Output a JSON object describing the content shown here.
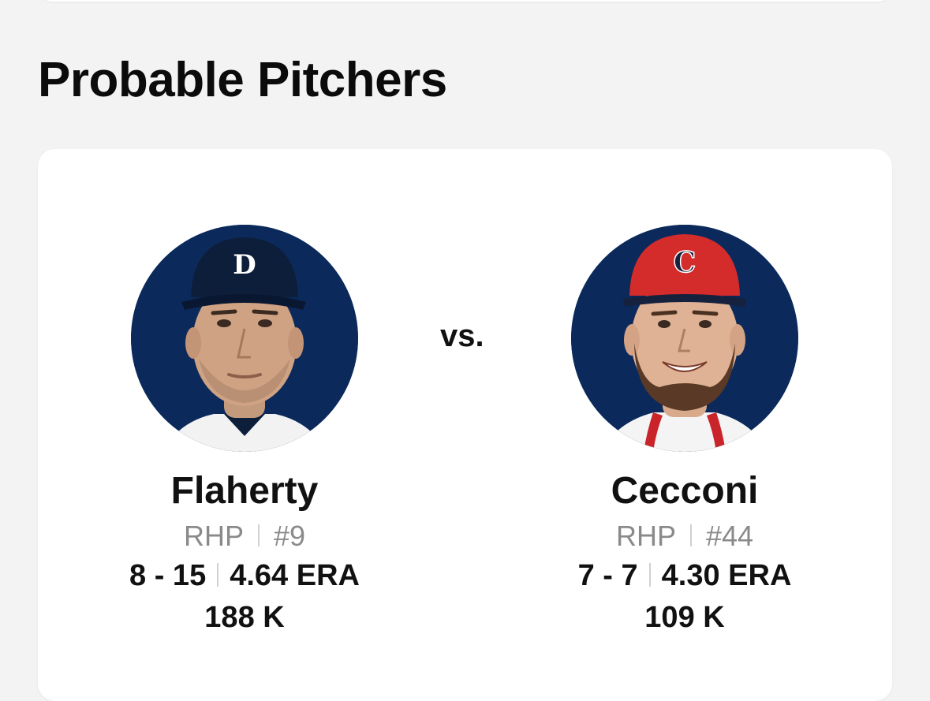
{
  "section": {
    "title": "Probable Pitchers"
  },
  "matchup": {
    "vs_label": "vs."
  },
  "pitchers": [
    {
      "name": "Flaherty",
      "position": "RHP",
      "number": "#9",
      "record": "8 - 15",
      "era": "4.64 ERA",
      "strikeouts": "188 K",
      "team_logo_letter": "D",
      "cap_color": "#0c1e3a",
      "bg_color": "#0b2a5b"
    },
    {
      "name": "Cecconi",
      "position": "RHP",
      "number": "#44",
      "record": "7 - 7",
      "era": "4.30 ERA",
      "strikeouts": "109 K",
      "team_logo_letter": "C",
      "cap_color": "#d42b2b",
      "bg_color": "#0b2a5b"
    }
  ]
}
